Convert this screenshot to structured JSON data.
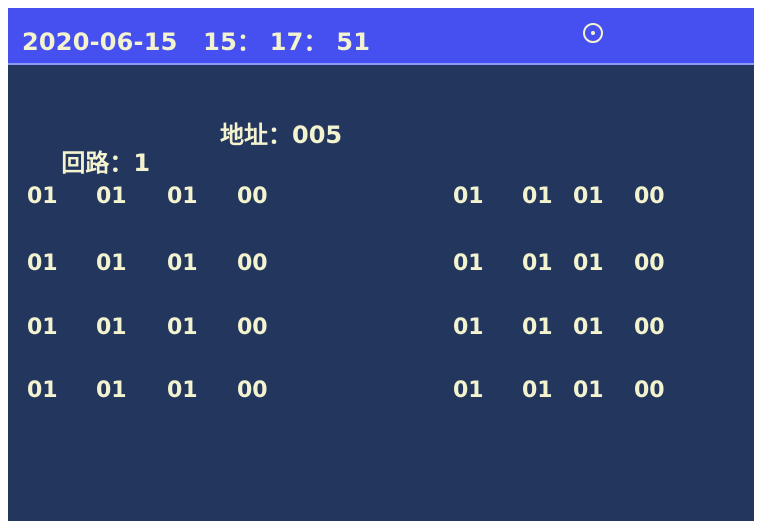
{
  "header": {
    "datetime": "2020-06-15   15： 17： 51",
    "status_icon": "circle-dot-icon"
  },
  "info": {
    "loop_label": "回路：",
    "loop_value": "1",
    "address_label": "地址：",
    "address_value": "005"
  },
  "data_rows": [
    {
      "left": [
        "01",
        "01",
        "01",
        "00"
      ],
      "right": [
        "01",
        "01",
        "01",
        "00"
      ]
    },
    {
      "left": [
        "01",
        "01",
        "01",
        "00"
      ],
      "right": [
        "01",
        "01",
        "01",
        "00"
      ]
    },
    {
      "left": [
        "01",
        "01",
        "01",
        "00"
      ],
      "right": [
        "01",
        "01",
        "01",
        "00"
      ]
    },
    {
      "left": [
        "01",
        "01",
        "01",
        "00"
      ],
      "right": [
        "01",
        "01",
        "01",
        "00"
      ]
    }
  ],
  "colors": {
    "background": "#22365e",
    "header": "#4650f0",
    "text": "#f3f3cf"
  }
}
